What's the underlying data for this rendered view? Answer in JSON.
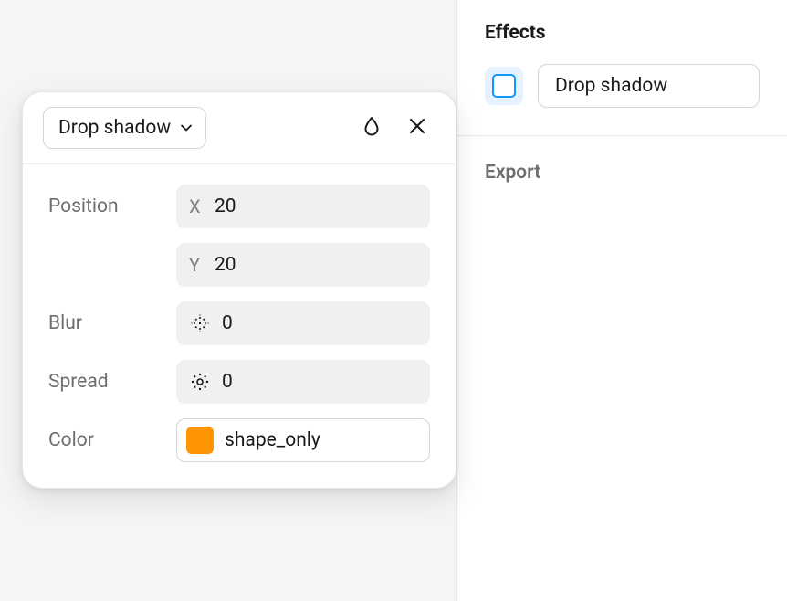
{
  "rightPanel": {
    "effects": {
      "title": "Effects",
      "item": {
        "label": "Drop shadow"
      }
    },
    "export": {
      "title": "Export"
    }
  },
  "popover": {
    "effectType": "Drop shadow",
    "labels": {
      "position": "Position",
      "blur": "Blur",
      "spread": "Spread",
      "color": "Color"
    },
    "position": {
      "x": {
        "prefix": "X",
        "value": "20"
      },
      "y": {
        "prefix": "Y",
        "value": "20"
      }
    },
    "blur": {
      "value": "0"
    },
    "spread": {
      "value": "0"
    },
    "color": {
      "hex": "#ff9500",
      "label": "shape_only"
    }
  }
}
